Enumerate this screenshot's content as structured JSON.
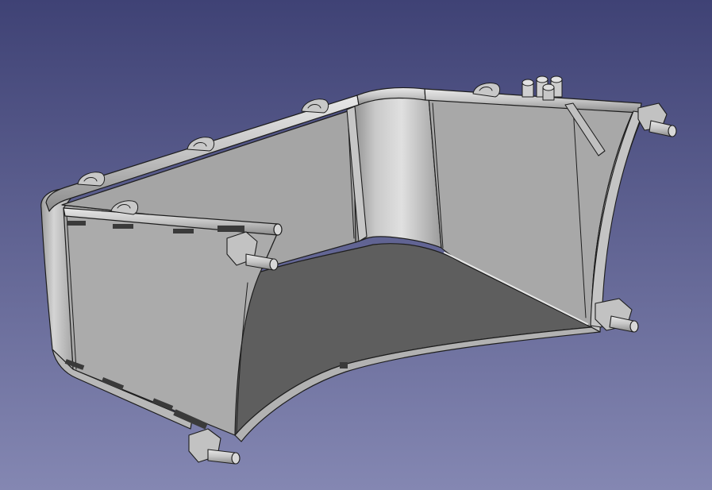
{
  "viewport": {
    "background_top": "#3f4275",
    "background_bottom": "#8487b2"
  },
  "model": {
    "light_face": "#ababab",
    "mid_face": "#9b9b9b",
    "dark_face": "#5e5e5e",
    "edge_color": "#1e1e1e",
    "tube_color": "#cdcdcd",
    "highlight": "#e4e4e4"
  }
}
